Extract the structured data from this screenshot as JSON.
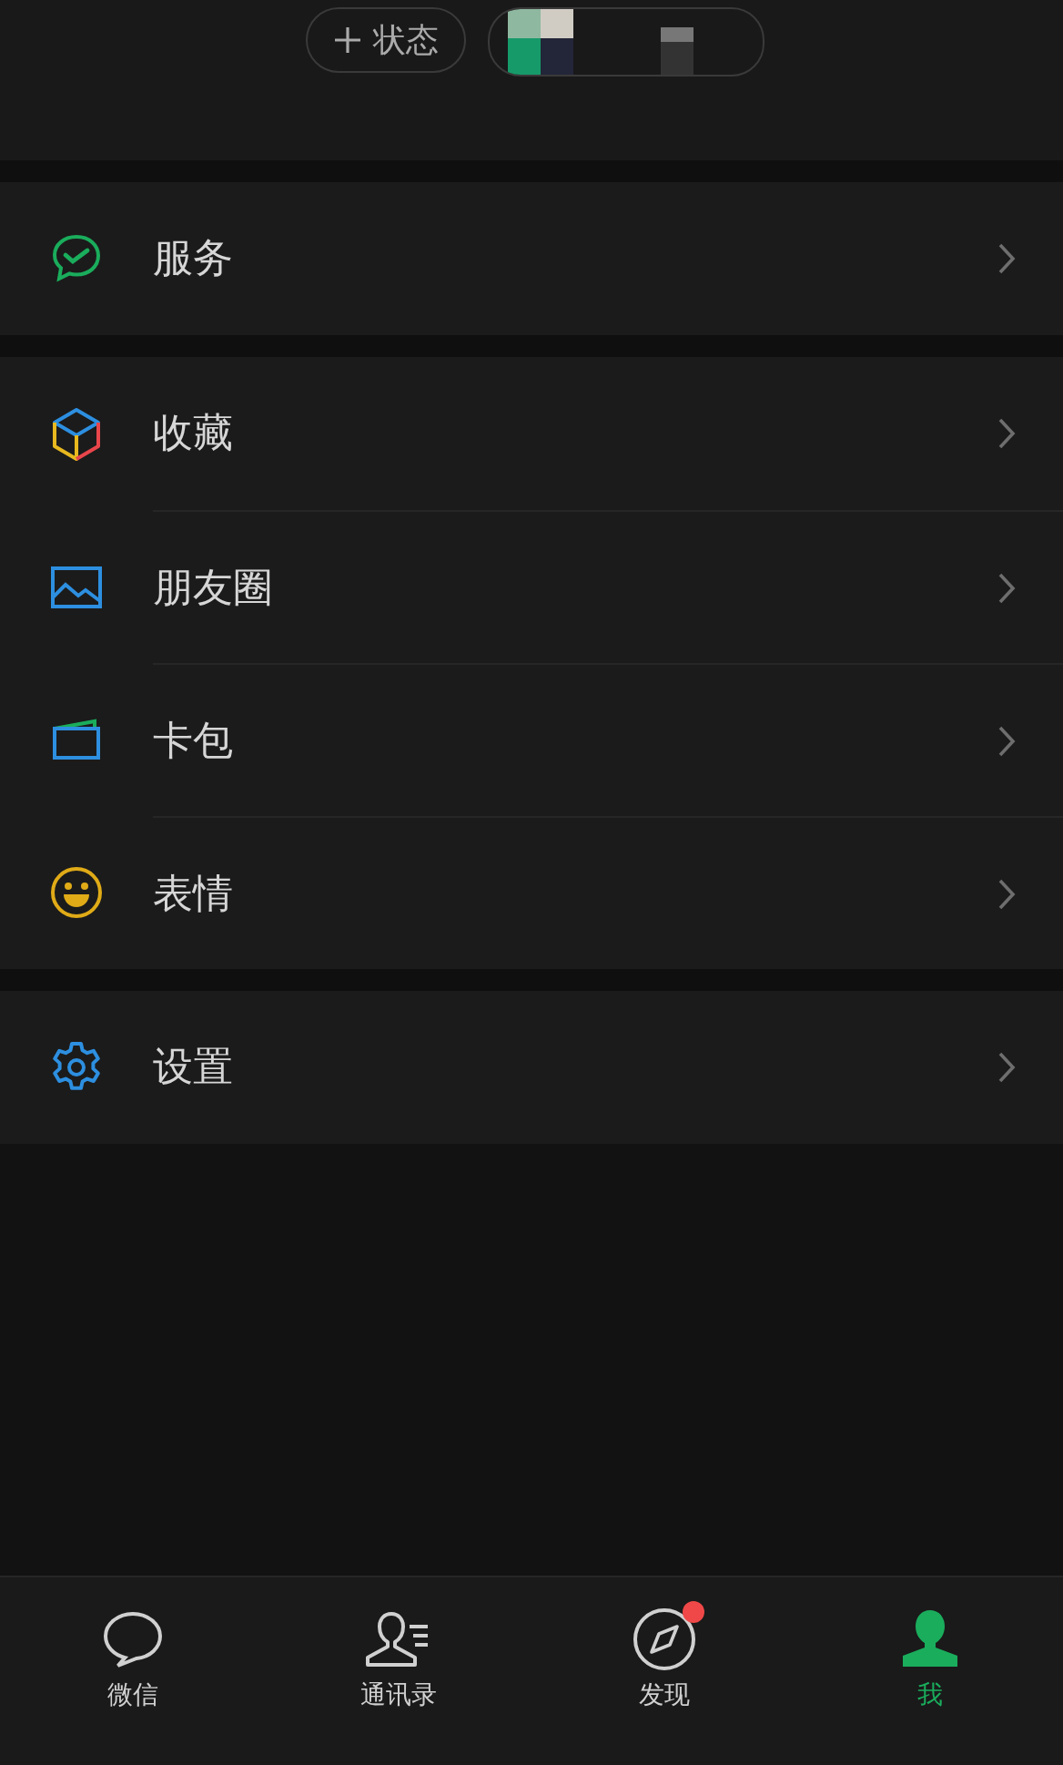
{
  "header": {
    "status_button": {
      "label": "状态"
    }
  },
  "sections": [
    {
      "items": [
        {
          "label": "服务",
          "kind": "services"
        }
      ]
    },
    {
      "items": [
        {
          "label": "收藏",
          "kind": "favorites"
        },
        {
          "label": "朋友圈",
          "kind": "moments"
        },
        {
          "label": "卡包",
          "kind": "cards"
        },
        {
          "label": "表情",
          "kind": "stickers"
        }
      ]
    },
    {
      "items": [
        {
          "label": "设置",
          "kind": "settings"
        }
      ]
    }
  ],
  "tabs": [
    {
      "label": "微信",
      "kind": "chats",
      "selected": false,
      "badge": false
    },
    {
      "label": "通讯录",
      "kind": "contacts",
      "selected": false,
      "badge": false
    },
    {
      "label": "发现",
      "kind": "discover",
      "selected": false,
      "badge": true
    },
    {
      "label": "我",
      "kind": "me",
      "selected": true,
      "badge": false
    }
  ]
}
